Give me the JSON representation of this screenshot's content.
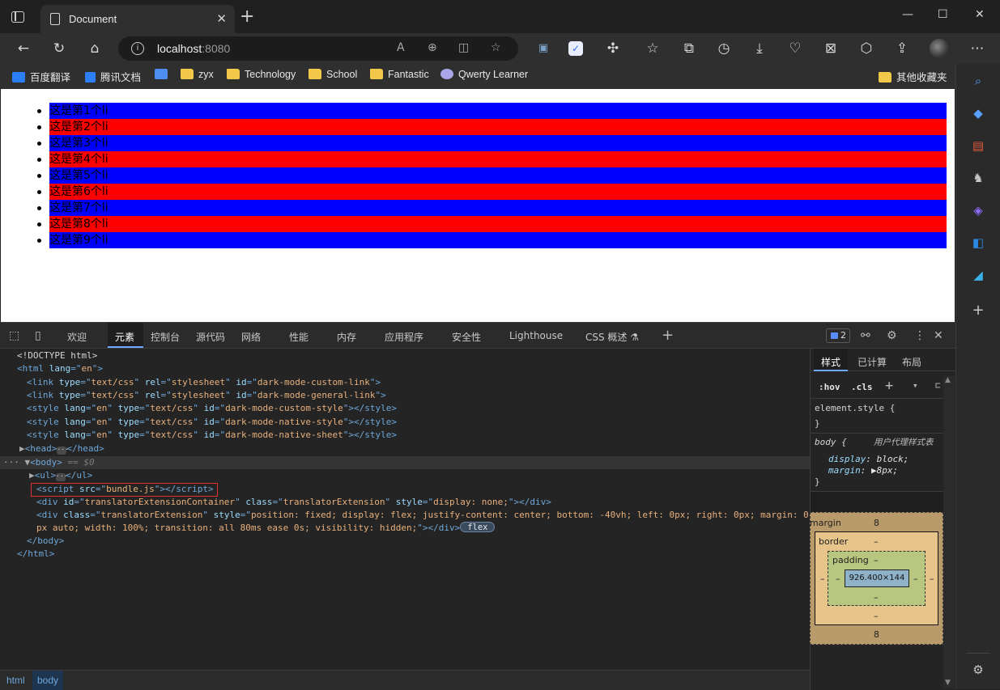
{
  "window": {
    "tab_title": "Document",
    "close_glyph": "✕",
    "new_tab_glyph": "+",
    "minimize_glyph": "—",
    "maximize_glyph": "☐",
    "close_window_glyph": "✕"
  },
  "address": {
    "host": "localhost",
    "port": ":8080"
  },
  "bookmarks": [
    {
      "label": "百度翻译",
      "icon": "baidu-translate-icon"
    },
    {
      "label": "腾讯文档",
      "icon": "tencent-docs-icon"
    },
    {
      "label": "",
      "icon": "google-translate-icon"
    },
    {
      "label": "zyx",
      "icon": "folder-icon"
    },
    {
      "label": "Technology",
      "icon": "folder-icon"
    },
    {
      "label": "School",
      "icon": "folder-icon"
    },
    {
      "label": "Fantastic",
      "icon": "folder-icon"
    },
    {
      "label": "Qwerty Learner",
      "icon": "qwerty-icon"
    },
    {
      "label": "其他收藏夹",
      "icon": "folder-icon"
    }
  ],
  "page": {
    "items": [
      {
        "text": "这是第1个li",
        "color": "#0000ff"
      },
      {
        "text": "这是第2个li",
        "color": "#ff0000"
      },
      {
        "text": "这是第3个li",
        "color": "#0000ff"
      },
      {
        "text": "这是第4个li",
        "color": "#ff0000"
      },
      {
        "text": "这是第5个li",
        "color": "#0000ff"
      },
      {
        "text": "这是第6个li",
        "color": "#ff0000"
      },
      {
        "text": "这是第7个li",
        "color": "#0000ff"
      },
      {
        "text": "这是第8个li",
        "color": "#ff0000"
      },
      {
        "text": "这是第9个li",
        "color": "#0000ff"
      }
    ]
  },
  "devtools": {
    "tabs": [
      "欢迎",
      "元素",
      "控制台",
      "源代码",
      "网络",
      "性能",
      "内存",
      "应用程序",
      "安全性",
      "Lighthouse",
      "CSS 概述"
    ],
    "active_tab": "元素",
    "issues_count": "2",
    "breadcrumbs": [
      "html",
      "body"
    ],
    "styles_tabs": [
      "样式",
      "已计算",
      "布局"
    ],
    "styles_toolbar": {
      "hov": ":hov",
      "cls": ".cls"
    },
    "element_style": "element.style {",
    "close_brace": "}",
    "body_rule": {
      "selector": "body {",
      "origin": "用户代理样式表",
      "display_prop": "display",
      "display_val": "block;",
      "margin_prop": "margin",
      "margin_val": "8px;"
    },
    "box_model": {
      "margin_label": "margin",
      "margin_value": "8",
      "border_label": "border",
      "border_value": "–",
      "padding_label": "padding",
      "padding_value": "–",
      "content_size": "926.400×144"
    },
    "code": {
      "doctype": "<!DOCTYPE html>",
      "html_lang": "en",
      "link1_id": "dark-mode-custom-link",
      "link2_id": "dark-mode-general-link",
      "style1_id": "dark-mode-custom-style",
      "style2_id": "dark-mode-native-style",
      "style3_id": "dark-mode-native-sheet",
      "selected_marker": "== $0",
      "script_src": "bundle.js",
      "div1_id": "translatorExtensionContainer",
      "div_class": "translatorExtension",
      "div1_style": "display: none;",
      "div2_style_a": "position: fixed; display: flex; justify-content: center; bottom: -40vh; left: 0px; right: 0px; margin: 0",
      "div2_style_b": "px auto; width: 100%; transition: all 80ms ease 0s; visibility: hidden;",
      "flex_badge": "flex"
    }
  }
}
